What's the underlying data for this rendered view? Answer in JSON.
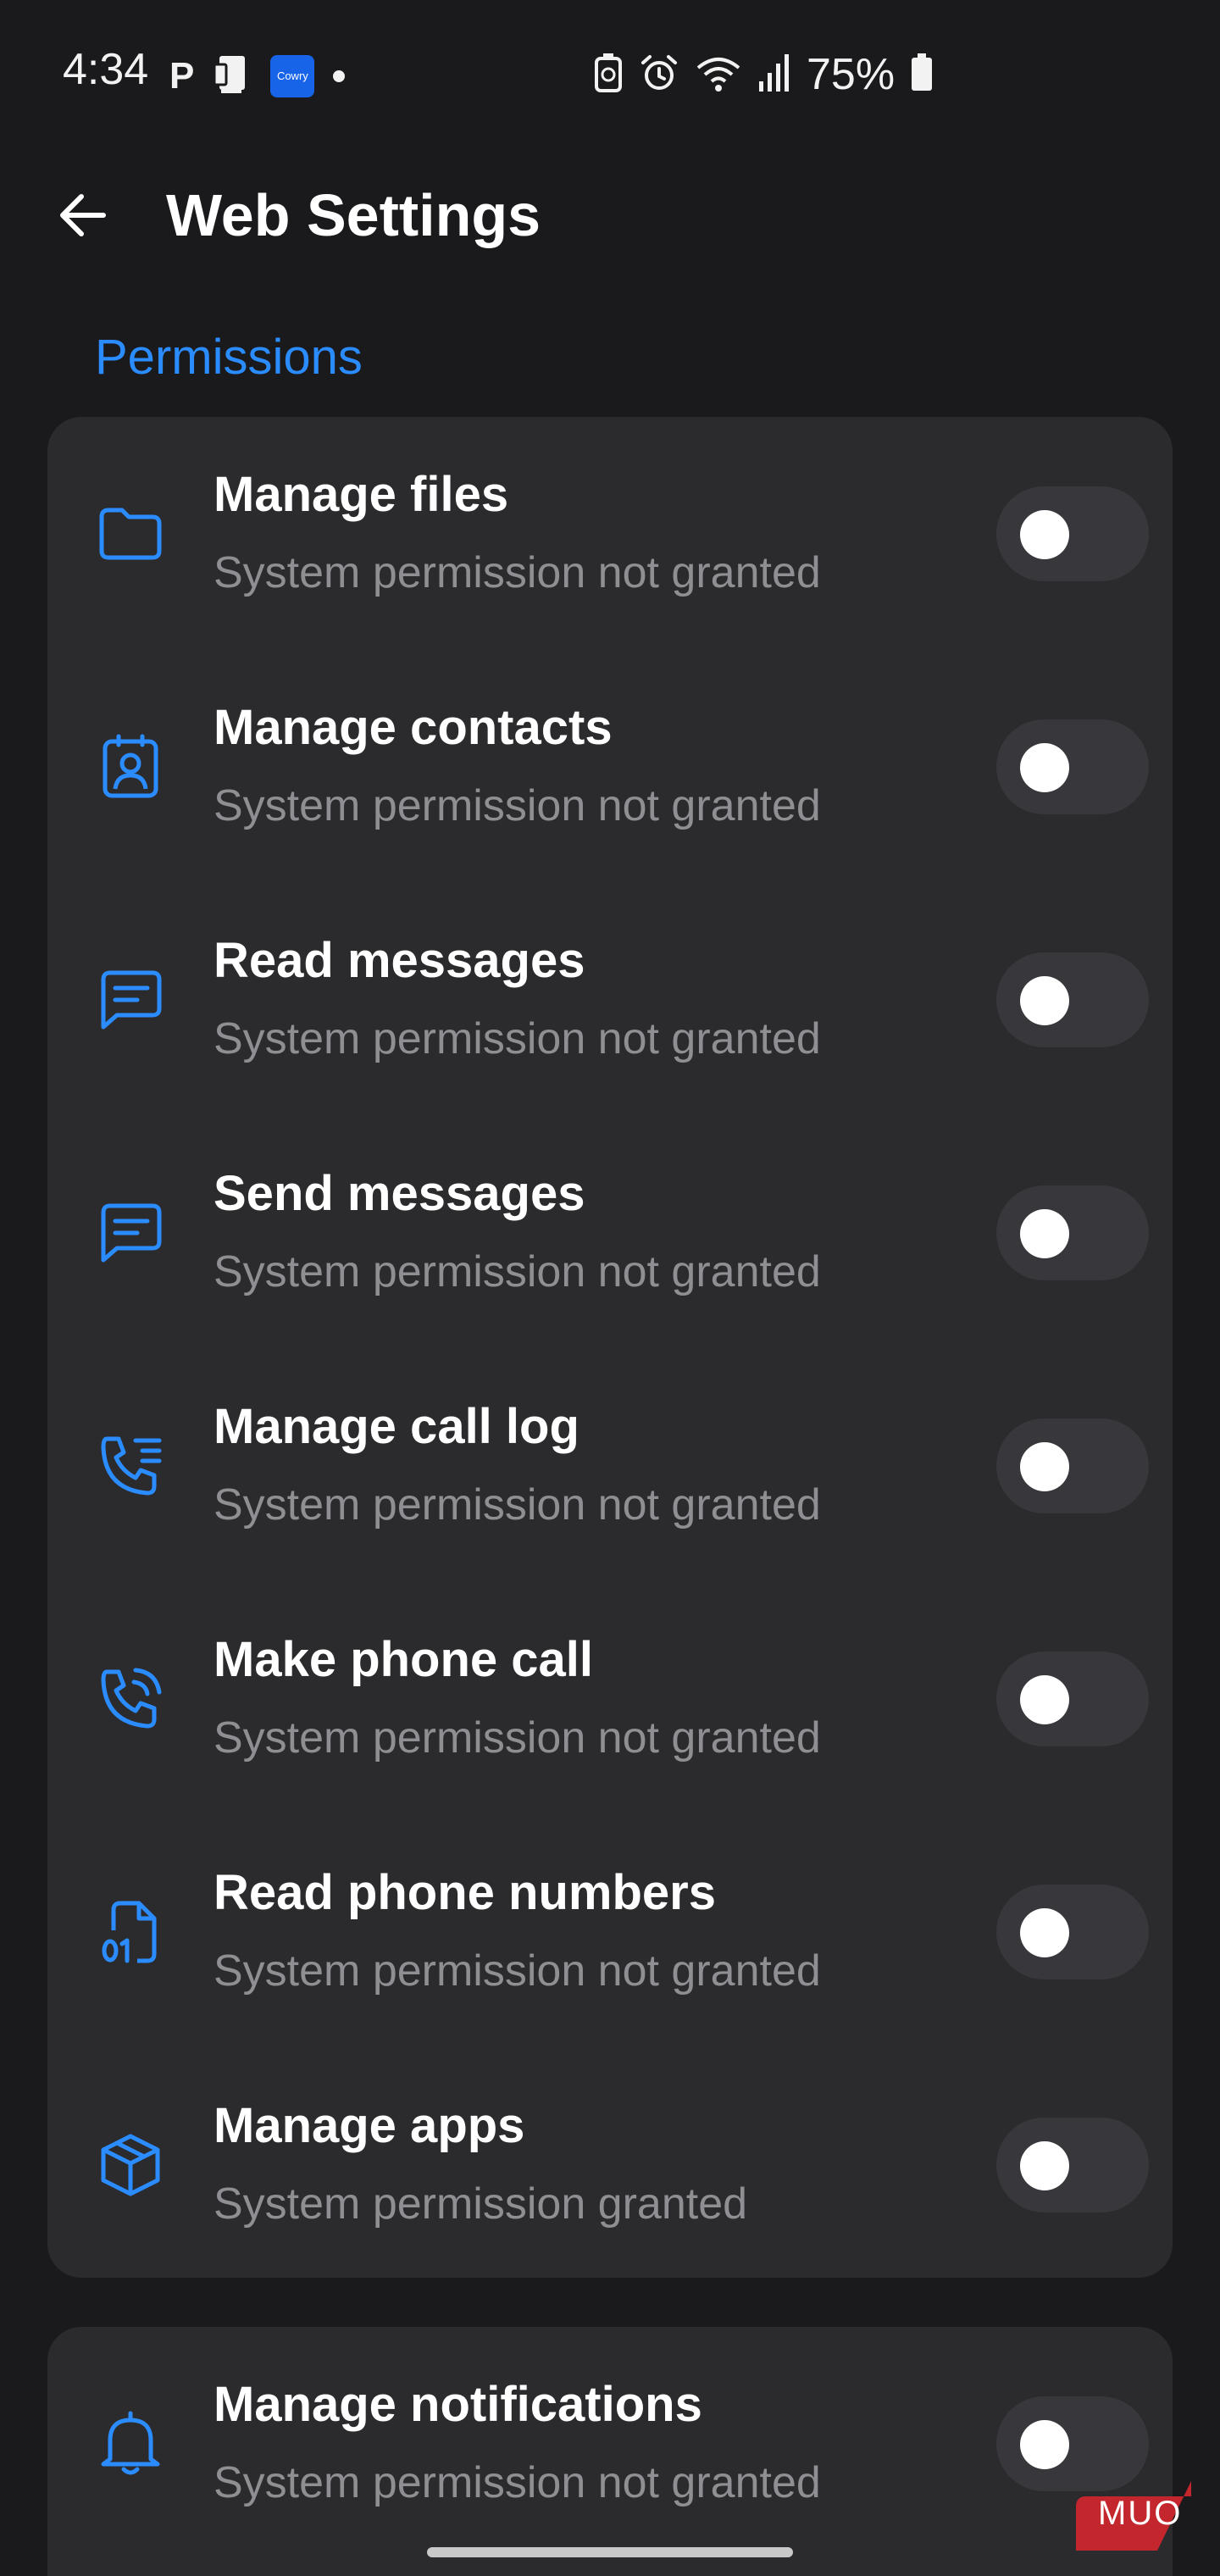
{
  "status_bar": {
    "time": "4:34",
    "p_label": "P",
    "cowry_label": "Cowry",
    "battery": "75%"
  },
  "header": {
    "title": "Web Settings"
  },
  "permissions": {
    "section_title": "Permissions",
    "items": [
      {
        "icon": "folder-icon",
        "title": "Manage files",
        "subtitle": "System permission not granted",
        "enabled": false
      },
      {
        "icon": "contact-badge-icon",
        "title": "Manage contacts",
        "subtitle": "System permission not granted",
        "enabled": false
      },
      {
        "icon": "message-icon",
        "title": "Read messages",
        "subtitle": "System permission not granted",
        "enabled": false
      },
      {
        "icon": "message-icon",
        "title": "Send messages",
        "subtitle": "System permission not granted",
        "enabled": false
      },
      {
        "icon": "phone-list-icon",
        "title": "Manage call log",
        "subtitle": "System permission not granted",
        "enabled": false
      },
      {
        "icon": "phone-outgoing-icon",
        "title": "Make phone call",
        "subtitle": "System permission not granted",
        "enabled": false
      },
      {
        "icon": "number-file-icon",
        "title": "Read phone numbers",
        "subtitle": "System permission not granted",
        "enabled": false
      },
      {
        "icon": "package-icon",
        "title": "Manage apps",
        "subtitle": "System permission granted",
        "enabled": false
      }
    ]
  },
  "notifications": {
    "items": [
      {
        "icon": "bell-icon",
        "title": "Manage notifications",
        "subtitle": "System permission not granted",
        "enabled": false
      }
    ]
  },
  "watermark": "MUO",
  "colors": {
    "background": "#1a1a1c",
    "card": "#2b2b2e",
    "accent": "#2b8cff",
    "subtitle": "#8e8e93",
    "toggle_track": "#38383c"
  }
}
